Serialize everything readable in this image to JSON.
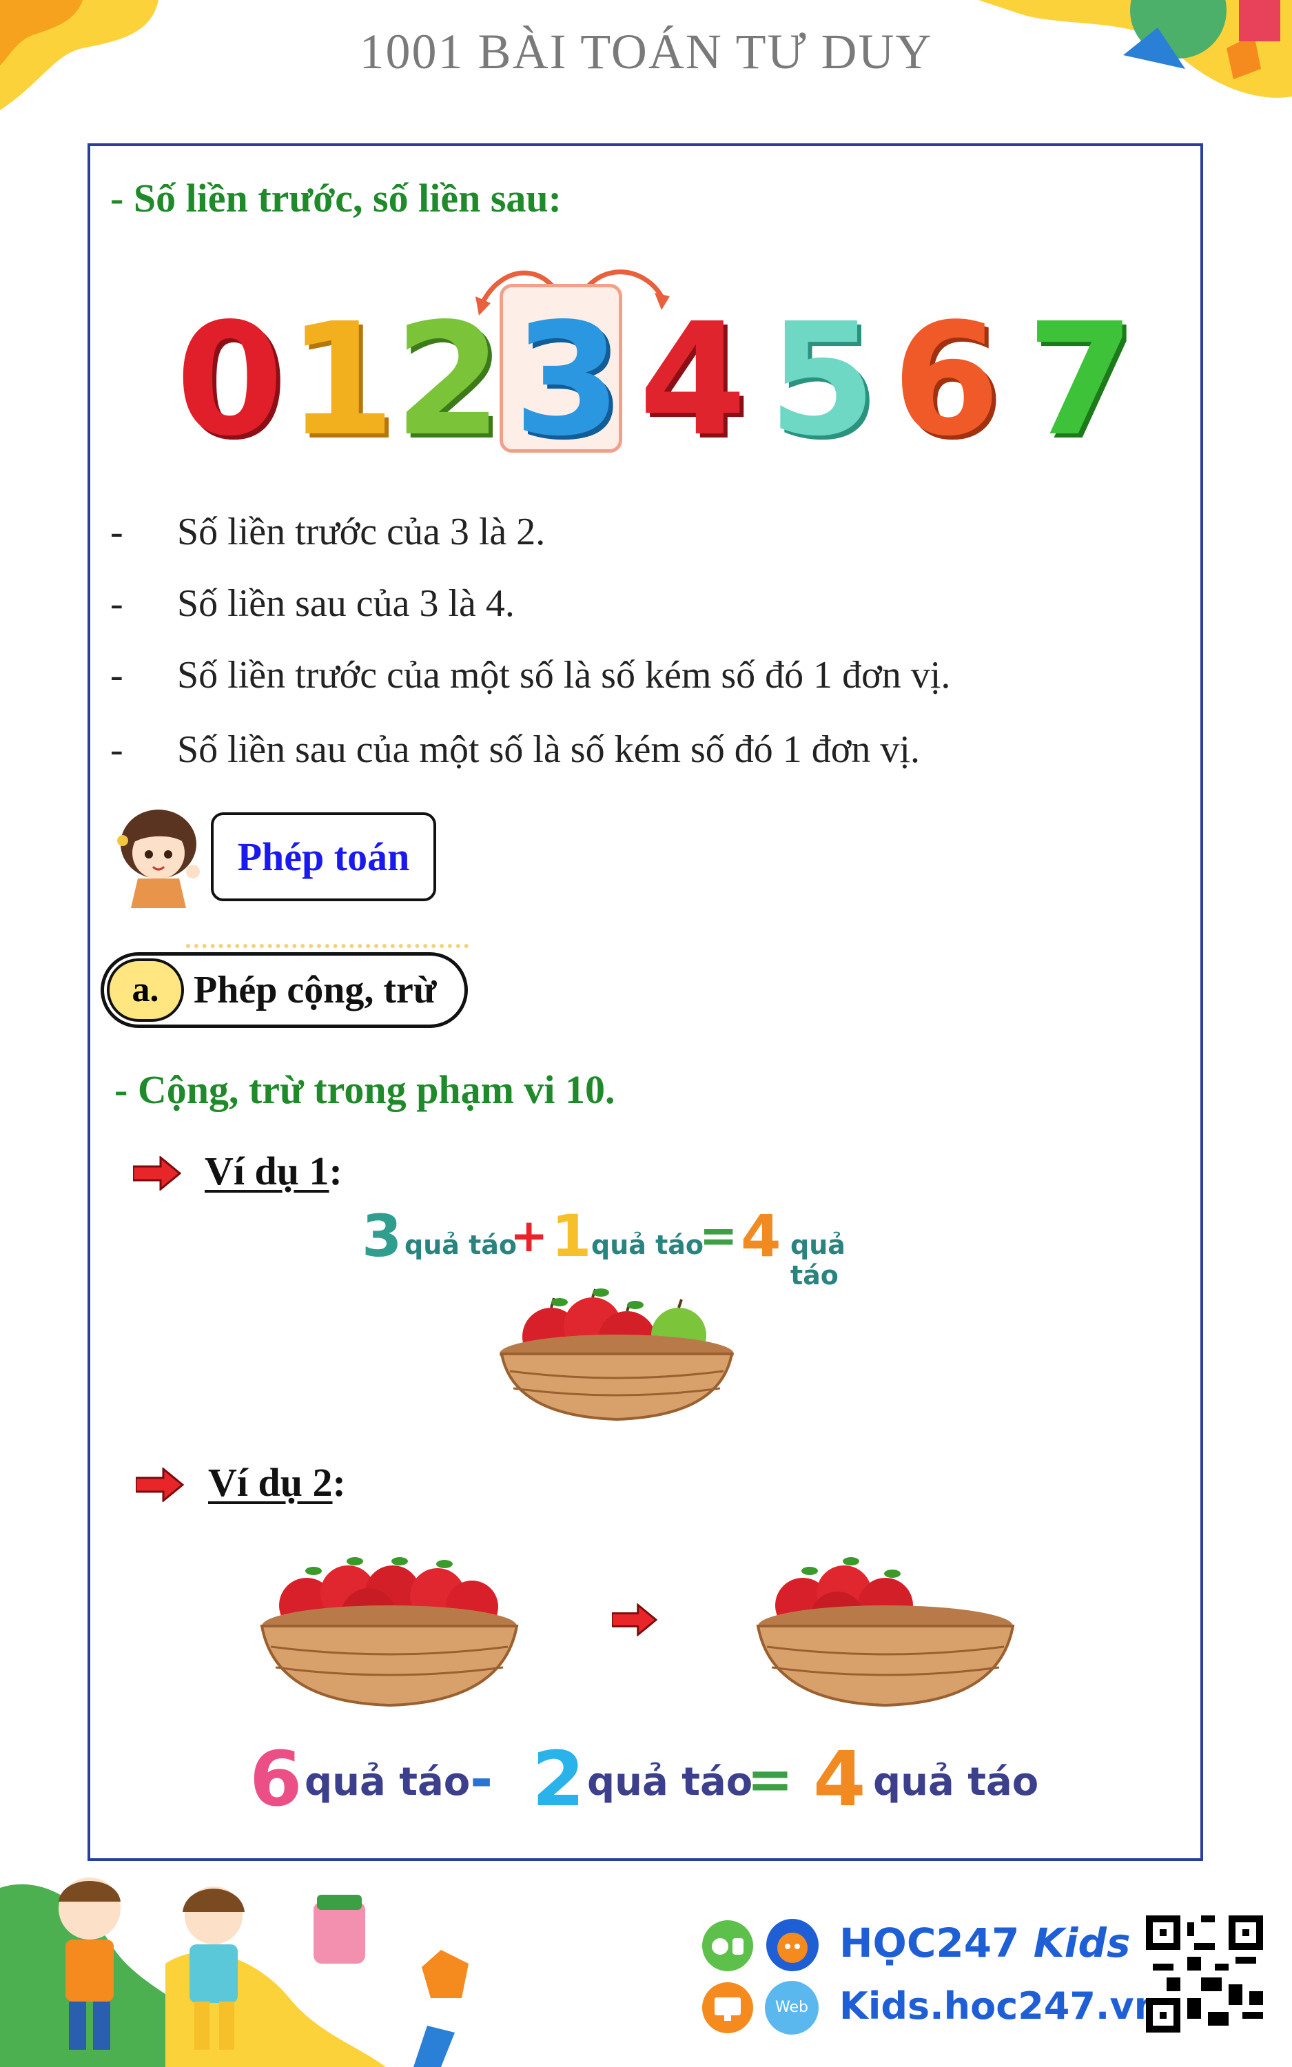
{
  "header": {
    "title": "1001 BÀI TOÁN TƯ DUY"
  },
  "section1": {
    "heading": "- Số liền trước, số liền sau:",
    "digits": [
      "0",
      "1",
      "2",
      "3",
      "4",
      "5",
      "6",
      "7"
    ],
    "digit_colors": [
      "#e01f2a",
      "#f2b01e",
      "#7bc43a",
      "#2a97e0",
      "#e0242e",
      "#6fd8c4",
      "#f05a28",
      "#3ec23a"
    ],
    "bullets": [
      {
        "dash": "-",
        "text": "Số liền trước của 3 là 2."
      },
      {
        "dash": "-",
        "text": "Số liền sau của 3 là 4."
      },
      {
        "dash": "-",
        "text": "Số liền trước của một số là số kém số đó 1 đơn vị."
      },
      {
        "dash": "-",
        "text": "Số liền sau của một số là số kém số đó 1 đơn vị."
      }
    ]
  },
  "topic_box": {
    "label": "Phép toán"
  },
  "subsection": {
    "badge": "a.",
    "label": "Phép cộng, trừ"
  },
  "range_heading": "- Cộng, trừ trong phạm vi 10.",
  "example1": {
    "title": "Ví dụ 1",
    "colon": ":",
    "a": "3",
    "a_unit": "quả táo",
    "op": "+",
    "b": "1",
    "b_unit": "quả táo",
    "eq": "=",
    "c": "4",
    "c_unit": "quả táo"
  },
  "example2": {
    "title": "Ví dụ 2",
    "colon": ":",
    "a": "6",
    "a_unit": "quả táo",
    "op": "-",
    "b": "2",
    "b_unit": "quả táo",
    "eq": "=",
    "c": "4",
    "c_unit": "quả táo"
  },
  "footer": {
    "brand_left": "HỌC247",
    "brand_right": "Kids",
    "website": "Kids.hoc247.vn",
    "web_badge": "Web"
  },
  "colors": {
    "frame": "#2a3f9c",
    "green_heading": "#1f8a2a",
    "topic_text": "#1a1aee",
    "brand_blue": "#1f5fd6"
  }
}
